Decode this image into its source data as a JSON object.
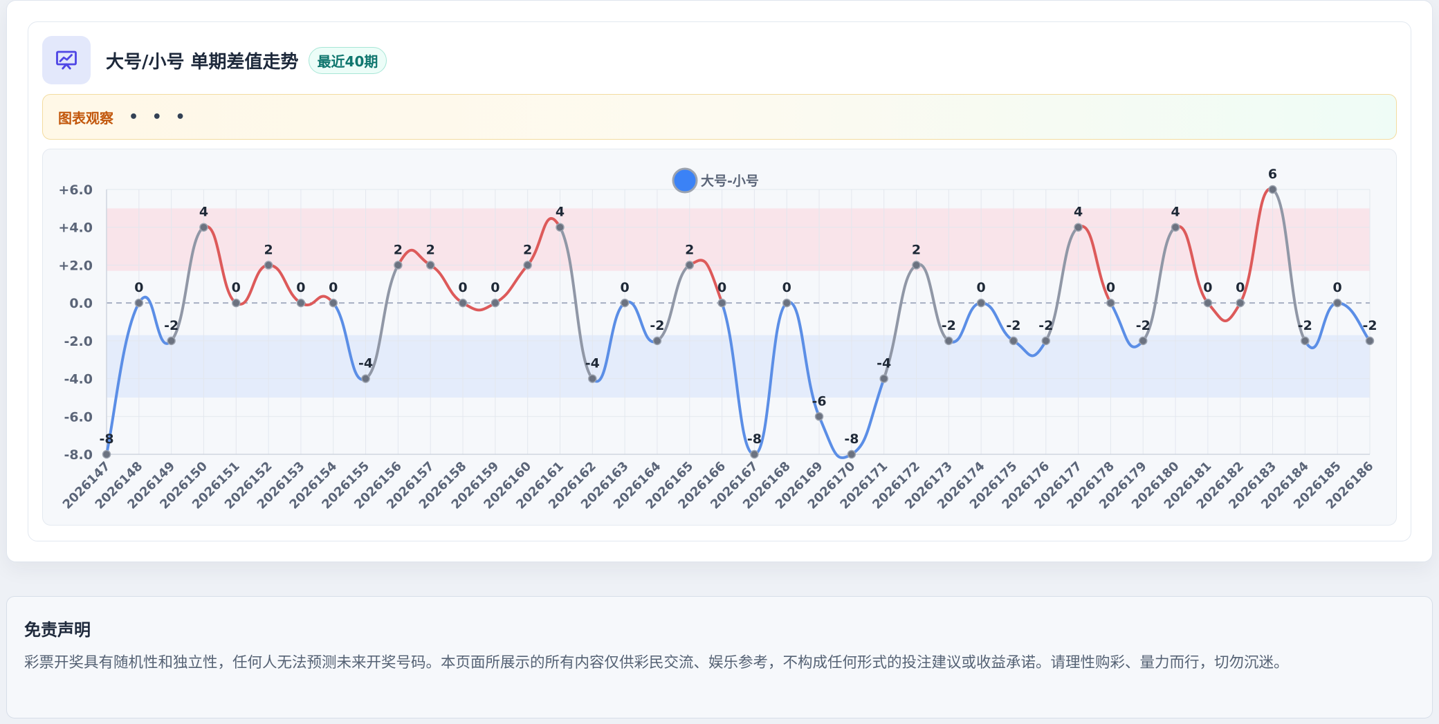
{
  "header": {
    "title": "大号/小号 单期差值走势",
    "badge": "最近40期",
    "icon": "presentation-chart-icon"
  },
  "observation": {
    "label": "图表观察",
    "loading": "• • •"
  },
  "colors": {
    "positive": "#dd5a5a",
    "negative": "#5b8ee6",
    "neutral": "#9097a6",
    "point": "#6b7280",
    "legend_dot": "#3b82f6",
    "positive_band": "#f9e1e6",
    "negative_band": "#e1eafa"
  },
  "chart_data": {
    "type": "line",
    "x": [
      "2026147",
      "2026148",
      "2026149",
      "2026150",
      "2026151",
      "2026152",
      "2026153",
      "2026154",
      "2026155",
      "2026156",
      "2026157",
      "2026158",
      "2026159",
      "2026160",
      "2026161",
      "2026162",
      "2026163",
      "2026164",
      "2026165",
      "2026166",
      "2026167",
      "2026168",
      "2026169",
      "2026170",
      "2026171",
      "2026172",
      "2026173",
      "2026174",
      "2026175",
      "2026176",
      "2026177",
      "2026178",
      "2026179",
      "2026180",
      "2026181",
      "2026182",
      "2026183",
      "2026184",
      "2026185",
      "2026186"
    ],
    "series": [
      {
        "name": "大号-小号",
        "values": [
          -8,
          0,
          -2,
          4,
          0,
          2,
          0,
          0,
          -4,
          2,
          2,
          0,
          0,
          2,
          4,
          -4,
          0,
          -2,
          2,
          0,
          -8,
          0,
          -6,
          -8,
          -4,
          2,
          -2,
          0,
          -2,
          -2,
          4,
          0,
          -2,
          4,
          0,
          0,
          6,
          -2,
          0,
          -2
        ]
      }
    ],
    "yticks": [
      "+6.0",
      "+4.0",
      "+2.0",
      "0.0",
      "-2.0",
      "-4.0",
      "-6.0",
      "-8.0"
    ],
    "ylim": [
      -8,
      6
    ],
    "bands": [
      [
        1.7,
        5.0
      ],
      [
        -5.0,
        -1.7
      ]
    ],
    "zero_line": "dashed",
    "grid": true,
    "legend_position": "top-center",
    "data_labels": true
  },
  "disclaimer": {
    "title": "免责声明",
    "text": "彩票开奖具有随机性和独立性，任何人无法预测未来开奖号码。本页面所展示的所有内容仅供彩民交流、娱乐参考，不构成任何形式的投注建议或收益承诺。请理性购彩、量力而行，切勿沉迷。"
  }
}
